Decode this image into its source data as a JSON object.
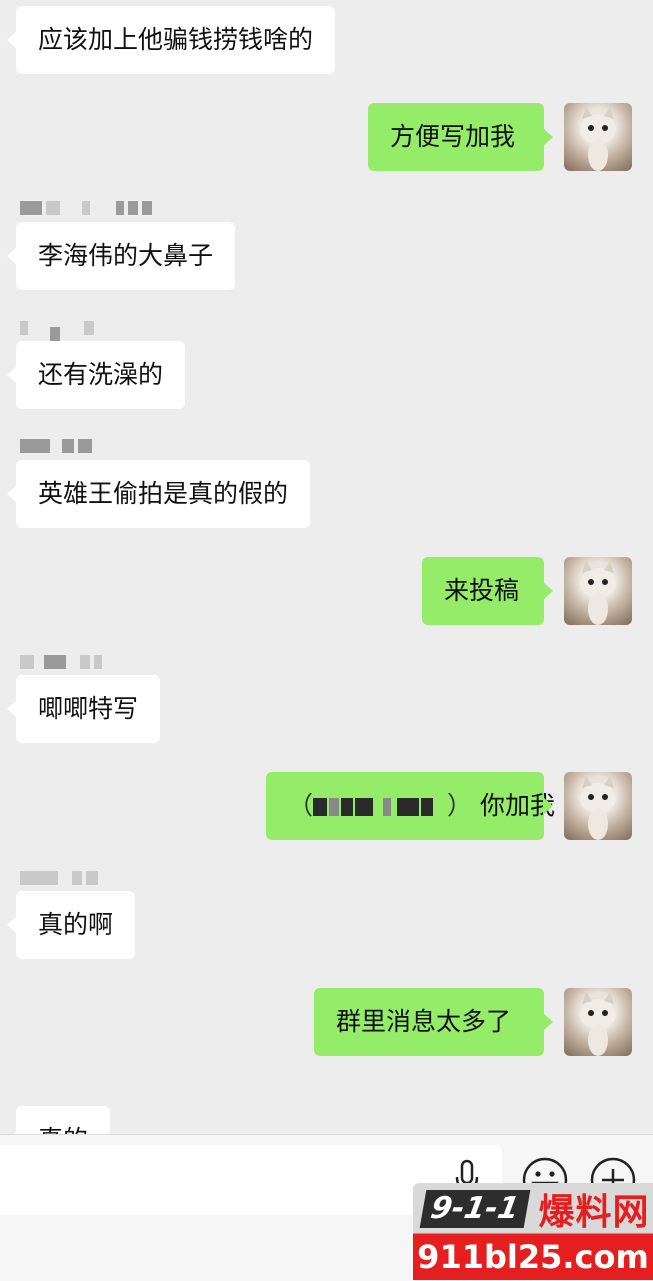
{
  "messages": [
    {
      "id": 0,
      "text": "应该加上他骗钱捞钱啥的"
    },
    {
      "id": 1,
      "text": "方便写加我"
    },
    {
      "id": 2,
      "text": "李海伟的大鼻子"
    },
    {
      "id": 3,
      "text": "还有洗澡的"
    },
    {
      "id": 4,
      "text": "英雄王偷拍是真的假的"
    },
    {
      "id": 5,
      "text": "来投稿"
    },
    {
      "id": 6,
      "text": "唧唧特写"
    },
    {
      "id": 7,
      "text": "你加我"
    },
    {
      "id": 8,
      "text": "真的啊"
    },
    {
      "id": 9,
      "text": "群里消息太多了"
    },
    {
      "id": 10,
      "text": "真的"
    }
  ],
  "censored_paren_open": "（",
  "censored_paren_close": "）",
  "watermark": {
    "badge": "9-1-1",
    "name": "爆料网",
    "url": "911bl25.com"
  },
  "colors": {
    "outgoing": "#95ec69",
    "incoming": "#ffffff",
    "background": "#ededed",
    "watermark_red": "#e51f1f"
  },
  "icons": [
    "microphone-icon",
    "emoji-icon",
    "plus-icon"
  ]
}
